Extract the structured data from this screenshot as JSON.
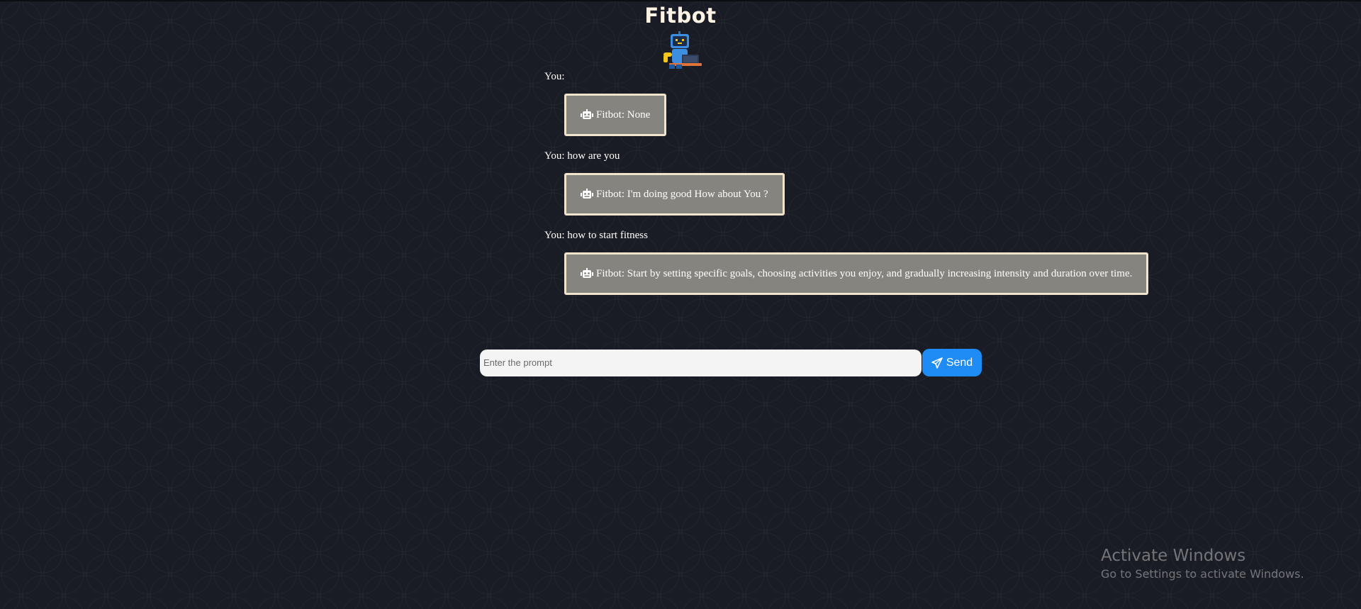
{
  "app": {
    "title": "Fitbot",
    "logo_icon": "robot-with-laptop-icon"
  },
  "chat": {
    "messages": [
      {
        "you": "You:",
        "bot": "Fitbot: None"
      },
      {
        "you": "You: how are you",
        "bot": "Fitbot: I'm doing good How about You ?"
      },
      {
        "you": "You: how to start fitness",
        "bot": "Fitbot: Start by setting specific goals, choosing activities you enjoy, and gradually increasing intensity and duration over time."
      }
    ],
    "bot_icon": "robot-icon"
  },
  "composer": {
    "placeholder": "Enter the prompt",
    "value": "",
    "send_label": "Send",
    "send_icon": "paper-plane-icon"
  },
  "watermark": {
    "title": "Activate Windows",
    "subtitle": "Go to Settings to activate Windows."
  },
  "colors": {
    "background": "#191c24",
    "bubble_bg": "#86847f",
    "bubble_border": "#f1e4cd",
    "send_button": "#1e8cf4",
    "title": "#fff3e3"
  }
}
